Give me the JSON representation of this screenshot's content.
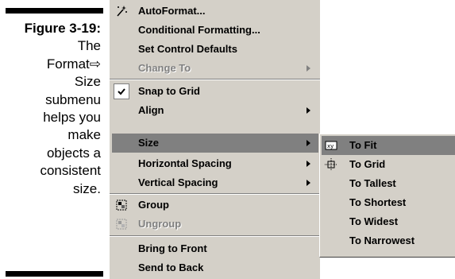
{
  "caption": {
    "figure_label": "Figure 3-19:",
    "lines": [
      "The",
      "Format⇨",
      "Size",
      "submenu",
      "helps you",
      "make",
      "objects a",
      "consistent",
      "size."
    ]
  },
  "menu": {
    "items": [
      {
        "label": "AutoFormat...",
        "icon": "autoformat-wand-icon"
      },
      {
        "label": "Conditional Formatting..."
      },
      {
        "label": "Set Control Defaults"
      },
      {
        "label": "Change To",
        "disabled": true,
        "submenu": true
      },
      {
        "label": "Snap to Grid",
        "icon": "checkmark-icon",
        "checked": true
      },
      {
        "label": "Align",
        "submenu": true
      },
      {
        "label": "Size",
        "submenu": true,
        "active": true
      },
      {
        "label": "Horizontal Spacing",
        "submenu": true
      },
      {
        "label": "Vertical Spacing",
        "submenu": true
      },
      {
        "label": "Group",
        "icon": "group-icon"
      },
      {
        "label": "Ungroup",
        "icon": "ungroup-icon",
        "disabled": true
      },
      {
        "label": "Bring to Front"
      },
      {
        "label": "Send to Back"
      }
    ]
  },
  "size_submenu": {
    "items": [
      {
        "label": "To Fit",
        "icon": "to-fit-icon",
        "active": true
      },
      {
        "label": "To Grid",
        "icon": "to-grid-icon"
      },
      {
        "label": "To Tallest"
      },
      {
        "label": "To Shortest"
      },
      {
        "label": "To Widest"
      },
      {
        "label": "To Narrowest"
      }
    ]
  },
  "colors": {
    "menu_bg": "#d4d0c8",
    "highlight": "#808080",
    "disabled_text": "#808080"
  }
}
